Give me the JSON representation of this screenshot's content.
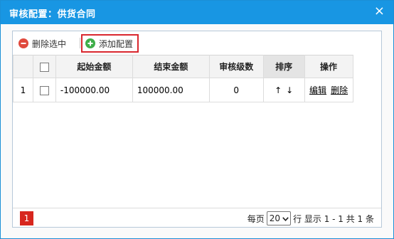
{
  "dialog": {
    "title": "审核配置：供货合同",
    "close_glyph": "×"
  },
  "toolbar": {
    "delete_label": "删除选中",
    "add_label": "添加配置"
  },
  "table": {
    "columns": [
      "",
      "",
      "起始金额",
      "结束金额",
      "审核级数",
      "排序",
      "操作"
    ],
    "rows": [
      {
        "index": "1",
        "start_amount": "-100000.00",
        "end_amount": "100000.00",
        "level": "0",
        "sort_up": "↑",
        "sort_down": "↓",
        "edit": "编辑",
        "delete": "删除"
      }
    ]
  },
  "pager": {
    "current_page": "1",
    "per_page_label": "每页",
    "per_page_value": "20",
    "summary": "行 显示 1 - 1 共 1 条"
  },
  "colors": {
    "titlebar": "#1896e3",
    "highlight_border": "#d9272e",
    "page_button": "#d7261e"
  }
}
